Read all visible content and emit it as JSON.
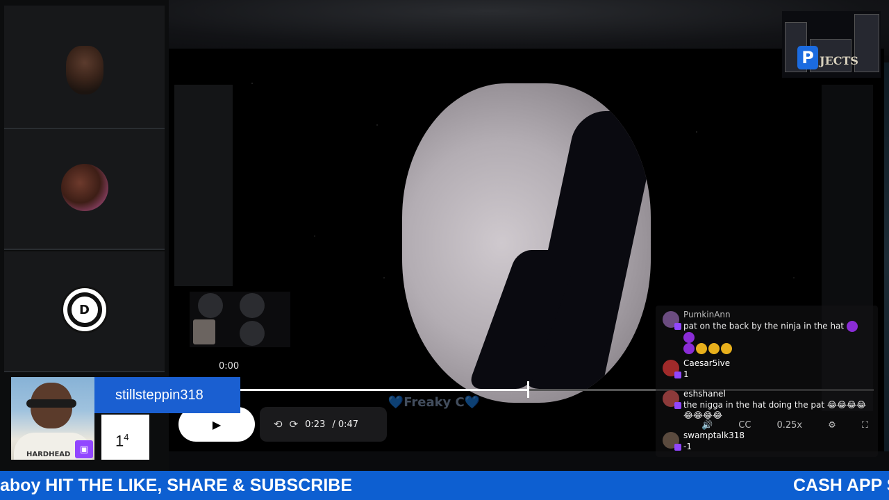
{
  "player": {
    "time_start": "0:00",
    "current_time": "0:23",
    "duration": "/ 0:47",
    "progress_fraction": 0.46,
    "speed": "0.25x",
    "watermark": "💙Freaky C💙"
  },
  "icons": {
    "play": "▶",
    "rewind": "⟲",
    "forward": "⟳",
    "volume": "🔊",
    "captions": "CC",
    "settings": "⚙",
    "fullscreen": "⛶"
  },
  "streamer": {
    "name": "stillsteppin318",
    "count_base": "1",
    "count_sup": "4",
    "shirt_text": "HARDHEAD"
  },
  "logo": {
    "letter": "P",
    "text": "JECTS"
  },
  "participants": [
    {
      "label": "participant-1"
    },
    {
      "label": "participant-2"
    },
    {
      "label": "participant-3",
      "logo_text": "D"
    }
  ],
  "chat": [
    {
      "user": "PumkinAnn",
      "text": "pat on the back by the ninja in the hat",
      "emotes_after": [
        "p",
        "p"
      ],
      "emotes_line2": [
        "p",
        "y",
        "y",
        "y"
      ]
    },
    {
      "user": "Caesar5ive",
      "text": "1"
    },
    {
      "user": "eshshanel",
      "text": "the nigga in the hat doing the pat 😂😂😂😂😂😂😂😂"
    },
    {
      "user": "swamptalk318",
      "text": "-1"
    }
  ],
  "ticker": {
    "left": "aboy HIT THE LIKE, SHARE & SUBSCRIBE",
    "right": "CASH APP S"
  },
  "colors": {
    "ticker_bg": "#0d5fd1",
    "name_bar": "#1a5fd1",
    "twitch": "#9146ff"
  }
}
